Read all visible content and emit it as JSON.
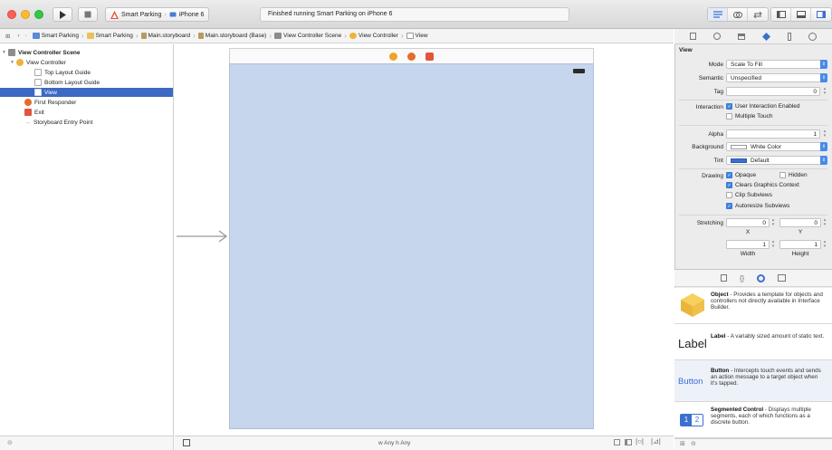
{
  "toolbar": {
    "scheme_app": "Smart Parking",
    "scheme_device": "iPhone 6",
    "status_text": "Finished running Smart Parking on iPhone 6"
  },
  "jumpbar": {
    "crumbs": [
      "Smart Parking",
      "Smart Parking",
      "Main.storyboard",
      "Main.storyboard (Base)",
      "View Controller Scene",
      "View Controller",
      "View"
    ]
  },
  "outline": {
    "items": [
      {
        "label": "View Controller Scene"
      },
      {
        "label": "View Controller"
      },
      {
        "label": "Top Layout Guide"
      },
      {
        "label": "Bottom Layout Guide"
      },
      {
        "label": "View"
      },
      {
        "label": "First Responder"
      },
      {
        "label": "Exit"
      },
      {
        "label": "Storyboard Entry Point"
      }
    ]
  },
  "canvas": {
    "size_class_w": "w Any",
    "size_class_h": "h Any"
  },
  "inspector": {
    "section_title": "View",
    "mode_label": "Mode",
    "mode_value": "Scale To Fill",
    "semantic_label": "Semantic",
    "semantic_value": "Unspecified",
    "tag_label": "Tag",
    "tag_value": "0",
    "interaction_label": "Interaction",
    "user_interaction": "User Interaction Enabled",
    "multiple_touch": "Multiple Touch",
    "alpha_label": "Alpha",
    "alpha_value": "1",
    "background_label": "Background",
    "background_value": "White Color",
    "tint_label": "Tint",
    "tint_value": "Default",
    "drawing_label": "Drawing",
    "opaque": "Opaque",
    "hidden": "Hidden",
    "clears_graphics": "Clears Graphics Context",
    "clip_subviews": "Clip Subviews",
    "autoresize": "Autoresize Subviews",
    "stretching_label": "Stretching",
    "stretch_x_value": "0",
    "stretch_y_value": "0",
    "stretch_w_value": "1",
    "stretch_h_value": "1",
    "x_label": "X",
    "y_label": "Y",
    "width_label": "Width",
    "height_label": "Height",
    "tint_color": "#3b6fd0"
  },
  "library": {
    "items": [
      {
        "title": "Object",
        "desc": " - Provides a template for objects and controllers not directly available in Interface Builder."
      },
      {
        "title": "Label",
        "desc": " - A variably sized amount of static text.",
        "preview": "Label"
      },
      {
        "title": "Button",
        "desc": " - Intercepts touch events and sends an action message to a target object when it's tapped.",
        "preview": "Button"
      },
      {
        "title": "Segmented Control",
        "desc": " - Displays multiple segments, each of which functions as a discrete button.",
        "seg1": "1",
        "seg2": "2"
      }
    ]
  }
}
